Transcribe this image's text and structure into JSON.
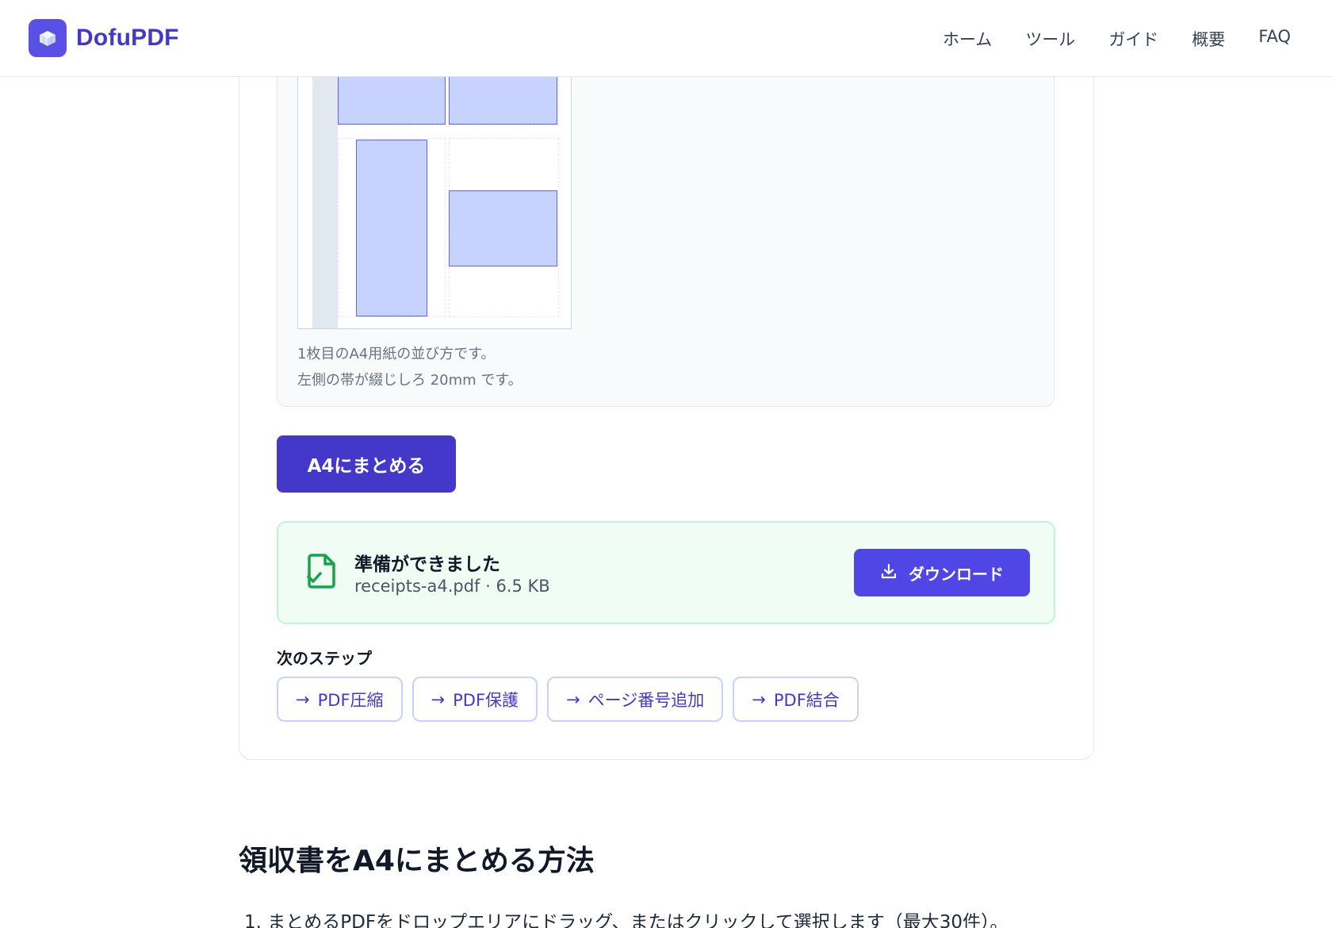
{
  "header": {
    "brand": "DofuPDF",
    "nav": [
      "ホーム",
      "ツール",
      "ガイド",
      "概要",
      "FAQ"
    ]
  },
  "preview": {
    "caption_line1": "1枚目のA4用紙の並び方です。",
    "caption_line2": "左側の帯が綴じしろ 20mm です。"
  },
  "actions": {
    "combine_label": "A4にまとめる"
  },
  "result": {
    "title": "準備ができました",
    "meta": "receipts-a4.pdf · 6.5 KB",
    "download_label": "ダウンロード"
  },
  "next_steps": {
    "title": "次のステップ",
    "items": [
      "PDF圧縮",
      "PDF保護",
      "ページ番号追加",
      "PDF結合"
    ]
  },
  "howto": {
    "title": "領収書をA4にまとめる方法",
    "step1": "1. まとめるPDFをドロップエリアにドラッグ、またはクリックして選択します（最大30件）。"
  },
  "colors": {
    "brand": "#4338ca",
    "accent": "#4f46e5",
    "success_bg": "#f0fdf4",
    "success_icon": "#16a34a"
  }
}
